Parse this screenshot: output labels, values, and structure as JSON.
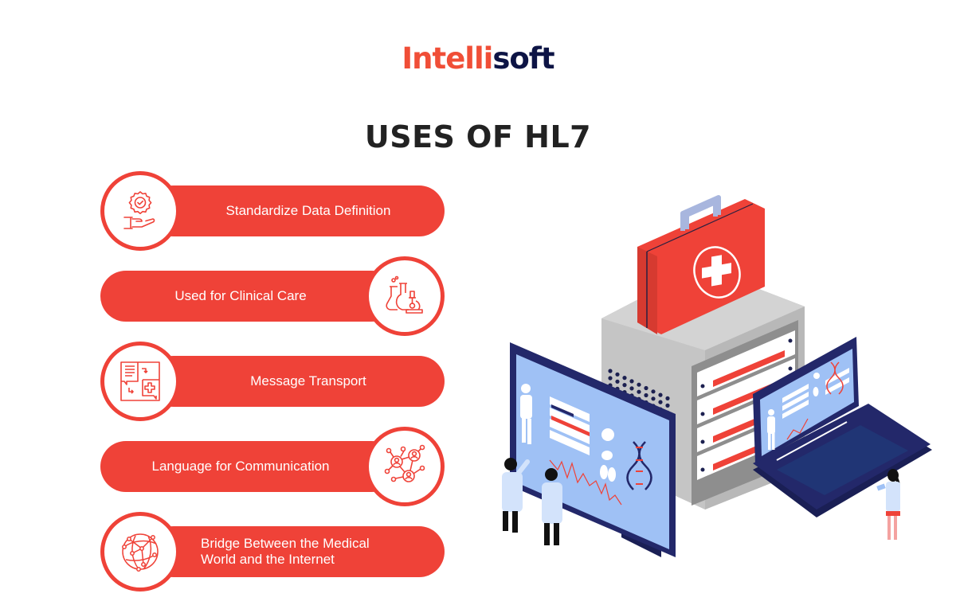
{
  "brand": {
    "logo_part1": "Intelli",
    "logo_part2": "soft",
    "color_primary": "#f04e37",
    "color_secondary": "#0d1445"
  },
  "header": {
    "title": "USES OF HL7"
  },
  "uses": [
    {
      "label": "Standardize Data Definition",
      "icon": "certified-hand-icon"
    },
    {
      "label": "Used for Clinical Care",
      "icon": "lab-flasks-microscope-icon"
    },
    {
      "label": "Message Transport",
      "icon": "message-exchange-icon"
    },
    {
      "label": "Language for Communication",
      "icon": "people-network-icon"
    },
    {
      "label": "Bridge Between the Medical World and the Internet",
      "icon": "globe-network-icon"
    }
  ],
  "illustration": {
    "description": "Isometric illustration of a medical kit on a server with a monitor, a laptop and doctors",
    "accent": "#ef4238",
    "navy": "#23286a",
    "screen": "#9fc1f5",
    "gray": "#c5c5c5"
  }
}
